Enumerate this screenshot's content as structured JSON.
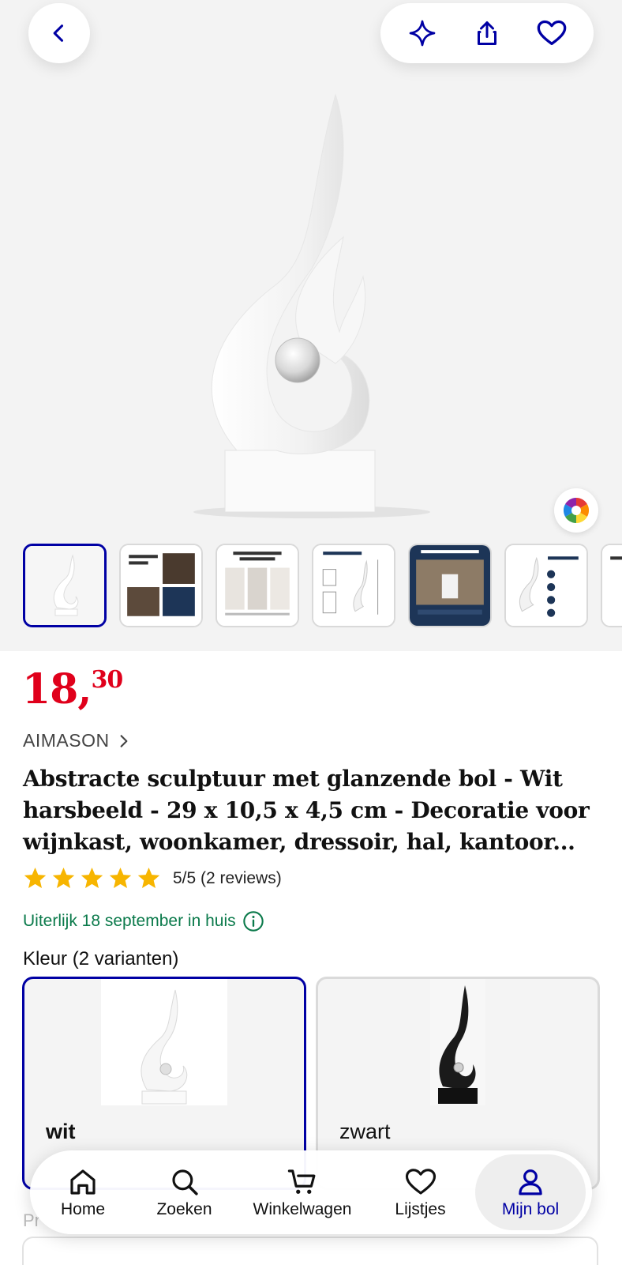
{
  "product": {
    "price_euros": "18,",
    "price_cents": "30",
    "brand": "AIMASON",
    "title": "Abstracte sculptuur met glanzende bol - Wit harsbeeld - 29 x 10,5 x 4,5 cm - Decoratie voor wijnkast, woonkamer, dressoir, hal, kantoor...",
    "rating_text": "5/5 (2 reviews)",
    "stars": 5,
    "delivery": "Uiterlijk 18 september in huis"
  },
  "thumbnails": [
    {
      "caption": ""
    },
    {
      "caption": "Perfect voor Elk Ruimte"
    },
    {
      "caption": "Superieure Materialen & Vakmanschap"
    },
    {
      "caption": "Productafmetingen"
    },
    {
      "caption": "Transformeer Uw Ruimte"
    },
    {
      "caption": "Elegante Decoratie voor Elk Interieur"
    }
  ],
  "variants": {
    "label": "Kleur (2 varianten)",
    "options": [
      {
        "name": "wit",
        "selected": true
      },
      {
        "name": "zwart",
        "selected": false
      }
    ]
  },
  "partial_section_label": "Pr",
  "nav": {
    "items": [
      {
        "label": "Home",
        "icon": "home-icon"
      },
      {
        "label": "Zoeken",
        "icon": "search-icon"
      },
      {
        "label": "Winkelwagen",
        "icon": "cart-icon"
      },
      {
        "label": "Lijstjes",
        "icon": "heart-icon"
      },
      {
        "label": "Mijn bol",
        "icon": "user-icon",
        "active": true
      }
    ]
  },
  "colors": {
    "accent": "#0000a4",
    "price": "#e0001b",
    "delivery": "#0b7a4b",
    "star": "#f7b500"
  }
}
